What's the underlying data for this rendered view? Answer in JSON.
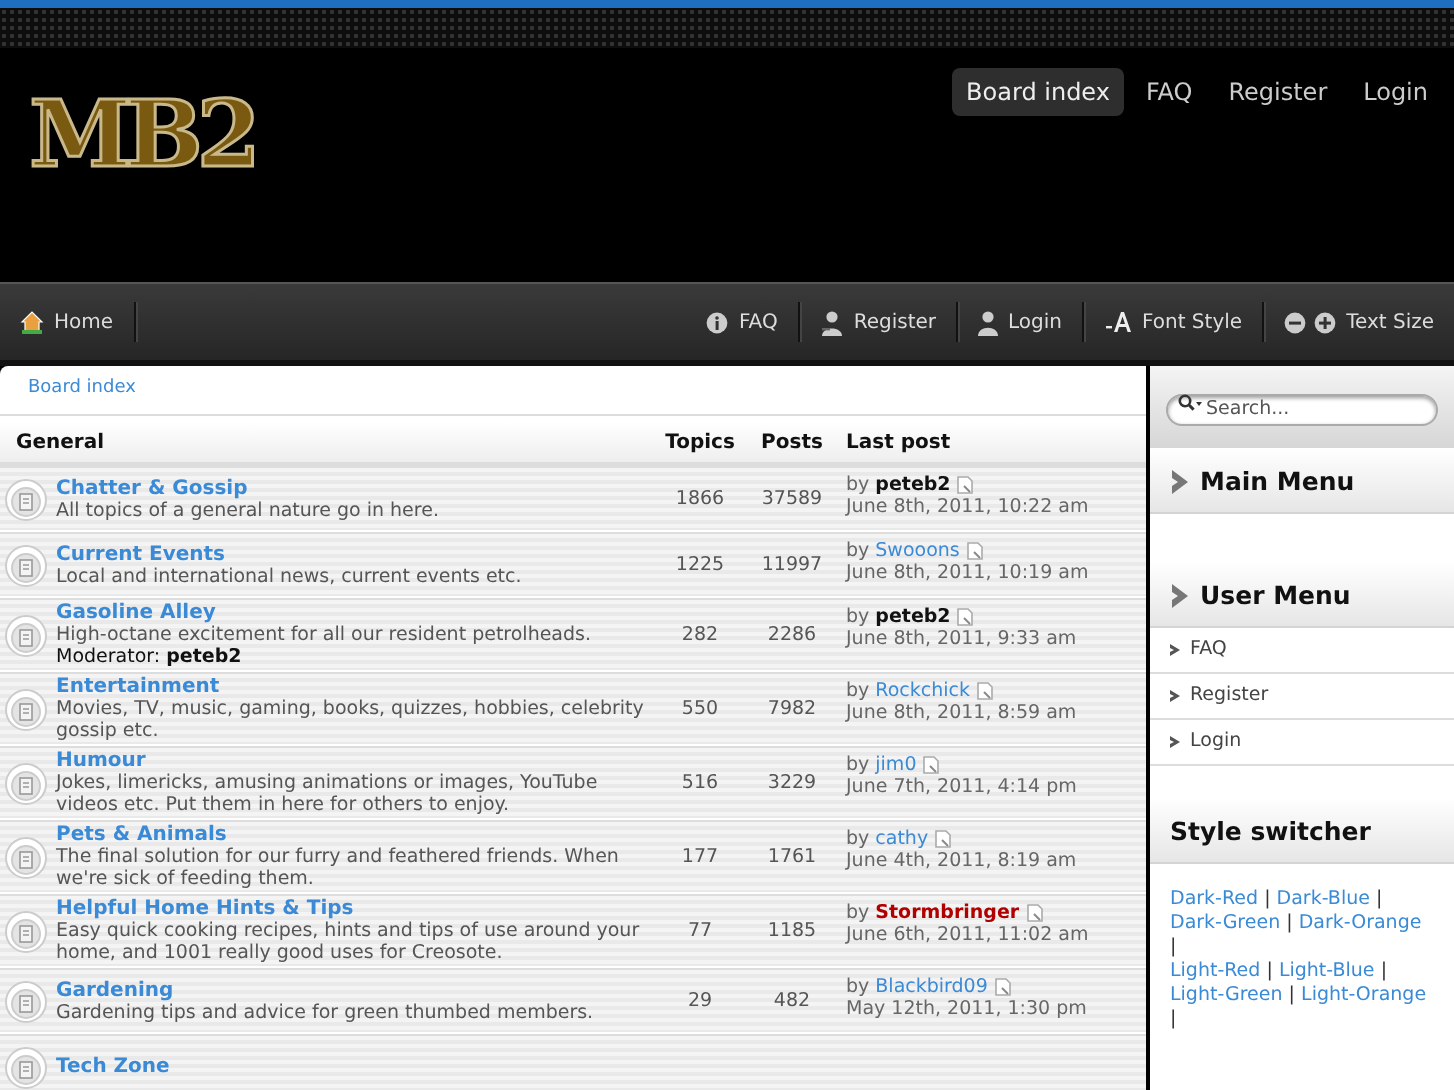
{
  "header": {
    "logo": "MB2",
    "top_links": [
      {
        "label": "Board index",
        "selected": true
      },
      {
        "label": "FAQ",
        "selected": false
      },
      {
        "label": "Register",
        "selected": false
      },
      {
        "label": "Login",
        "selected": false
      }
    ]
  },
  "navbar": {
    "left": [
      {
        "label": "Home",
        "kind": "home"
      }
    ],
    "right": [
      {
        "label": "FAQ",
        "kind": "info"
      },
      {
        "label": "Register",
        "kind": "register"
      },
      {
        "label": "Login",
        "kind": "user"
      },
      {
        "label": "Font Style",
        "kind": "font"
      },
      {
        "label": "Text Size",
        "kind": "size"
      }
    ]
  },
  "breadcrumb": "Board index",
  "forum": {
    "columns": [
      "General",
      "Topics",
      "Posts",
      "Last post"
    ],
    "rows": [
      {
        "title": "Chatter & Gossip",
        "description": "All topics of a general nature go in here.",
        "topics": "1866",
        "posts": "37589",
        "last_post": {
          "by": "by",
          "poster": "peteb2",
          "color": "#111111",
          "bold": true,
          "date": "June 8th, 2011, 10:22 am"
        }
      },
      {
        "title": "Current Events",
        "description": "Local and international news, current events etc.",
        "topics": "1225",
        "posts": "11997",
        "last_post": {
          "by": "by",
          "poster": "Swooons",
          "color": "#3a8ad6",
          "bold": false,
          "date": "June 8th, 2011, 10:19 am"
        }
      },
      {
        "title": "Gasoline Alley",
        "description": "High-octane excitement for all our resident petrolheads.",
        "moderator": "Moderator: **peteb2**",
        "topics": "282",
        "posts": "2286",
        "last_post": {
          "by": "by",
          "poster": "peteb2",
          "color": "#111111",
          "bold": true,
          "date": "June 8th, 2011, 9:33 am"
        }
      },
      {
        "title": "Entertainment",
        "description": "Movies, TV, music, gaming, books, quizzes, hobbies, celebrity gossip etc.",
        "topics": "550",
        "posts": "7982",
        "last_post": {
          "by": "by",
          "poster": "Rockchick",
          "color": "#3a8ad6",
          "bold": false,
          "date": "June 8th, 2011, 8:59 am"
        }
      },
      {
        "title": "Humour",
        "description": "Jokes, limericks, amusing animations or images, YouTube videos etc. Put them in here for others to enjoy.",
        "topics": "516",
        "posts": "3229",
        "last_post": {
          "by": "by",
          "poster": "jim0",
          "color": "#3a8ad6",
          "bold": false,
          "date": "June 7th, 2011, 4:14 pm"
        }
      },
      {
        "title": "Pets & Animals",
        "description": "The final solution for our furry and feathered friends. When we're sick of feeding them.",
        "topics": "177",
        "posts": "1761",
        "last_post": {
          "by": "by",
          "poster": "cathy",
          "color": "#3a8ad6",
          "bold": false,
          "date": "June 4th, 2011, 8:19 am"
        }
      },
      {
        "title": "Helpful Home Hints & Tips",
        "description": "Easy quick cooking recipes, hints and tips of use around your home, and 1001 really good uses for Creosote.",
        "topics": "77",
        "posts": "1185",
        "last_post": {
          "by": "by",
          "poster": "Stormbringer",
          "color": "#b00000",
          "bold": true,
          "date": "June 6th, 2011, 11:02 am"
        }
      },
      {
        "title": "Gardening",
        "description": "Gardening tips and advice for green thumbed members.",
        "topics": "29",
        "posts": "482",
        "last_post": {
          "by": "by",
          "poster": "Blackbird09",
          "color": "#3a8ad6",
          "bold": false,
          "date": "May 12th, 2011, 1:30 pm"
        }
      },
      {
        "title": "Tech Zone"
      }
    ]
  },
  "sidebar": {
    "search": {
      "placeholder": "Search..."
    },
    "main_menu": {
      "title": "Main Menu"
    },
    "user_menu": {
      "title": "User Menu",
      "items": [
        "FAQ",
        "Register",
        "Login"
      ]
    },
    "style_switcher": {
      "title": "Style switcher",
      "links": [
        "Dark-Red",
        "Dark-Blue",
        "Dark-Green",
        "Dark-Orange",
        "Light-Red",
        "Light-Blue",
        "Light-Green",
        "Light-Orange"
      ],
      "separator": "|"
    }
  }
}
